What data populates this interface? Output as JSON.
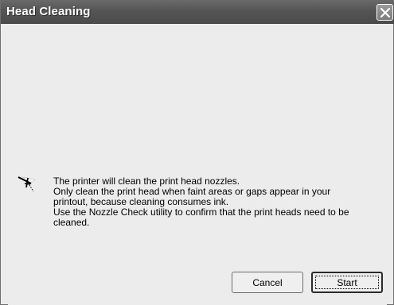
{
  "window": {
    "title": "Head Cleaning"
  },
  "message": {
    "lines": [
      "The printer will clean the print head nozzles.",
      "Only clean the print head when faint areas or gaps appear in your",
      "printout, because cleaning consumes ink.",
      "Use the Nozzle Check utility to confirm that the print heads need to be",
      "cleaned."
    ],
    "icon": "printer-head-icon"
  },
  "buttons": {
    "cancel_label": "Cancel",
    "start_label": "Start"
  },
  "colors": {
    "titlebar": "#555555",
    "dialog_background": "#ececec"
  }
}
